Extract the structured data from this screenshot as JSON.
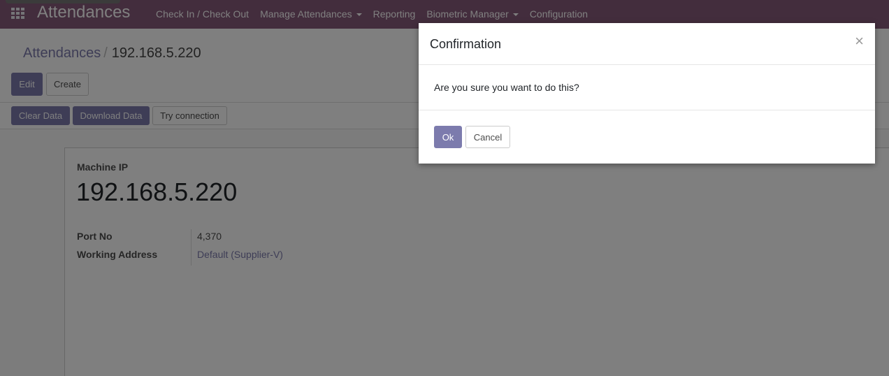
{
  "navbar": {
    "app_title": "Attendances",
    "menu": [
      {
        "label": "Check In / Check Out",
        "dropdown": false
      },
      {
        "label": "Manage Attendances",
        "dropdown": true
      },
      {
        "label": "Reporting",
        "dropdown": false
      },
      {
        "label": "Biometric Manager",
        "dropdown": true
      },
      {
        "label": "Configuration",
        "dropdown": false
      }
    ]
  },
  "breadcrumb": {
    "parent": "Attendances",
    "separator": "/",
    "current": "192.168.5.220"
  },
  "control_panel": {
    "edit_label": "Edit",
    "create_label": "Create"
  },
  "header_buttons": {
    "clear_data": "Clear Data",
    "download_data": "Download Data",
    "try_connection": "Try connection"
  },
  "form": {
    "machine_ip_label": "Machine IP",
    "machine_ip_value": "192.168.5.220",
    "port_label": "Port No",
    "port_value": "4,370",
    "address_label": "Working Address",
    "address_value": "Default (Supplier-V)"
  },
  "modal": {
    "title": "Confirmation",
    "close_glyph": "×",
    "message": "Are you sure you want to do this?",
    "ok_label": "Ok",
    "cancel_label": "Cancel"
  },
  "colors": {
    "navbar": "#875a7b",
    "primary": "#7c7bad"
  },
  "icons": {
    "apps": "apps-grid-icon",
    "close": "close-icon",
    "dropdown": "caret-down-icon"
  }
}
